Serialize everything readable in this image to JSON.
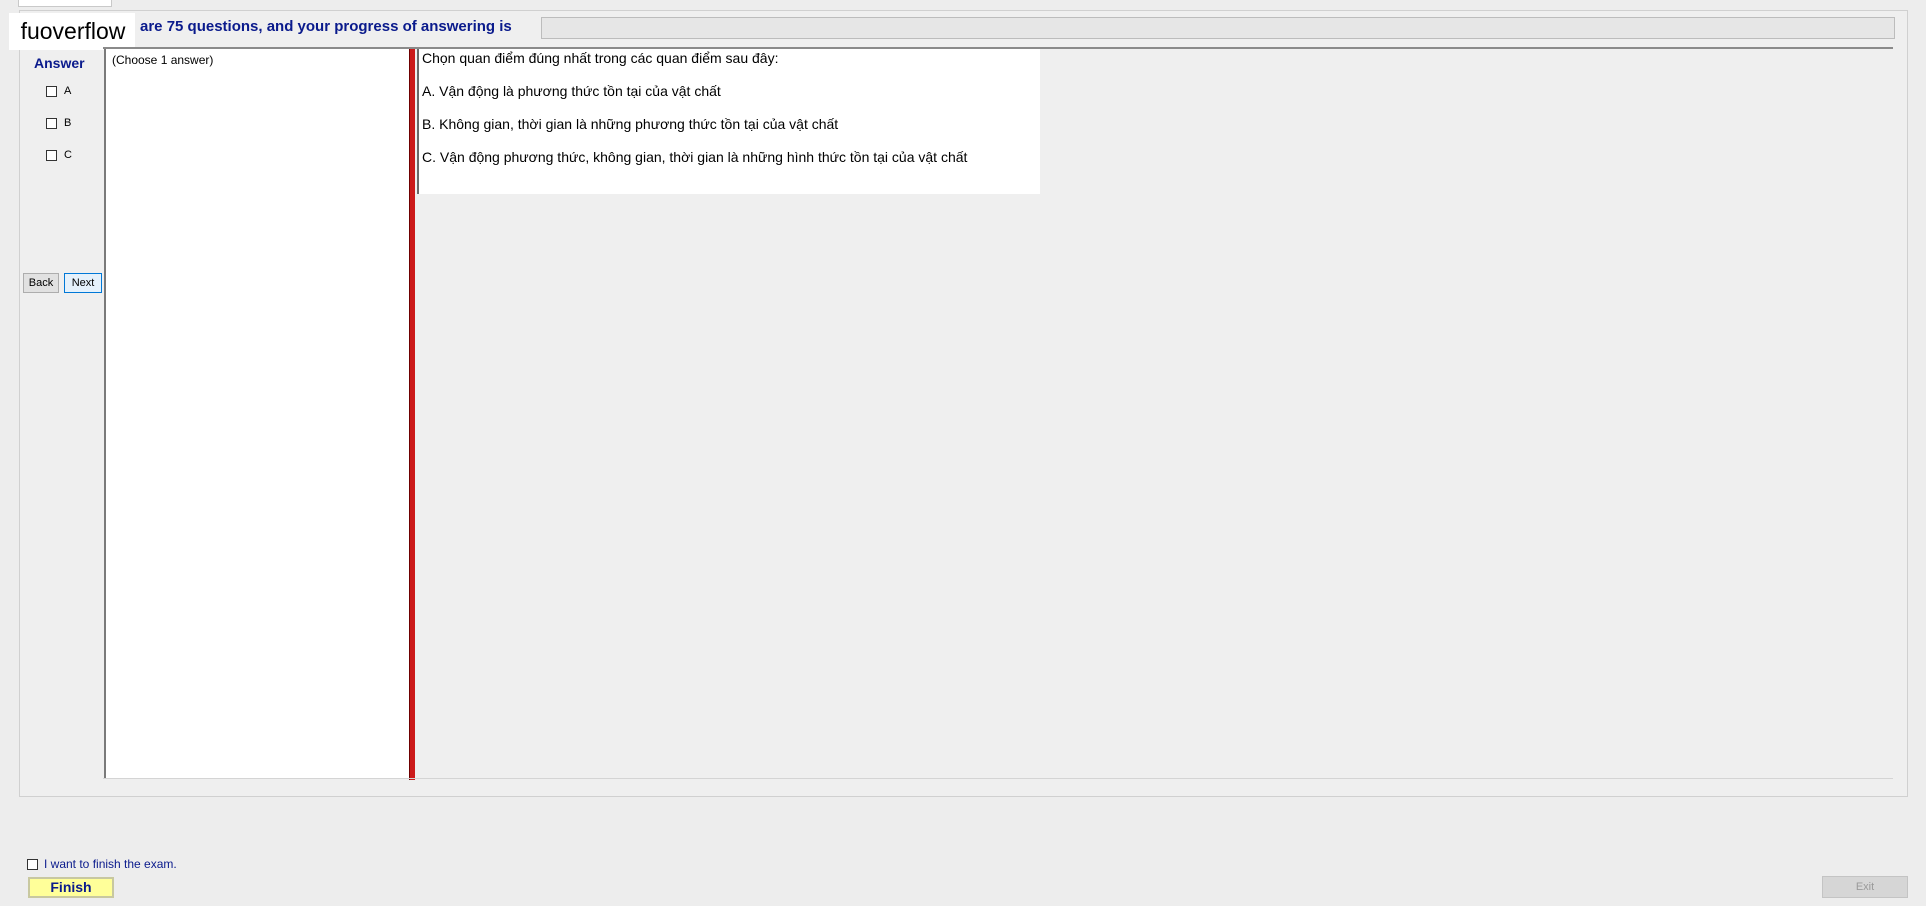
{
  "header": {
    "watermark": "fuoverflow",
    "progress_text": "are 75 questions, and your progress of answering is",
    "progress_fraction": 0
  },
  "answer_panel": {
    "title": "Answer",
    "options": [
      "A",
      "B",
      "C"
    ]
  },
  "nav": {
    "back_label": "Back",
    "next_label": "Next"
  },
  "choose": {
    "label": "(Choose 1 answer)"
  },
  "question": {
    "lines": [
      "Chọn quan điểm đúng nhất trong các quan điểm sau đây:",
      "A.  Vận động là phương thức tồn tại của vật chất",
      "B.  Không gian, thời gian là những phương thức tồn tại của vật chất",
      "C.  Vận động phương thức, không gian, thời gian là những hình thức tồn tại của vật chất"
    ]
  },
  "footer": {
    "finish_check_label": "I want to finish the exam.",
    "finish_label": "Finish",
    "exit_label": "Exit"
  },
  "colors": {
    "accent_text": "#0a1a8c",
    "splitter": "#cc1a1a",
    "finish_button": "#ffff99"
  }
}
